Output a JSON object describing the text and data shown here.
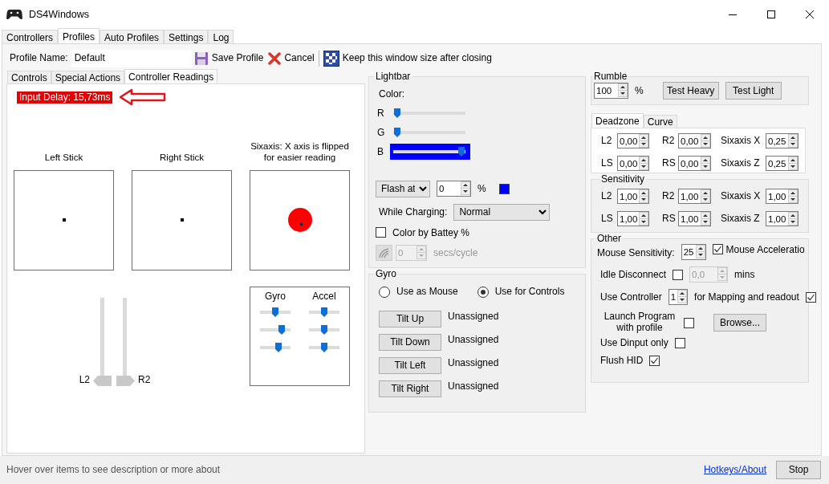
{
  "window": {
    "title": "DS4Windows"
  },
  "main_tabs": [
    {
      "label": "Controllers",
      "selected": false
    },
    {
      "label": "Profiles",
      "selected": true
    },
    {
      "label": "Auto Profiles",
      "selected": false
    },
    {
      "label": "Settings",
      "selected": false
    },
    {
      "label": "Log",
      "selected": false
    }
  ],
  "profile_bar": {
    "label": "Profile Name:",
    "value": "Default",
    "save": "Save Profile",
    "cancel": "Cancel",
    "keep_size": "Keep this window size after closing"
  },
  "sub_tabs": [
    {
      "label": "Controls",
      "selected": false
    },
    {
      "label": "Special Actions",
      "selected": false
    },
    {
      "label": "Controller Readings",
      "selected": true
    }
  ],
  "readings": {
    "input_delay": "Input Delay: 15,73ms",
    "sticks": [
      {
        "label": "Left Stick"
      },
      {
        "label": "Right Stick"
      }
    ],
    "sixaxis_label": "Sixaxis: X axis is flipped for easier reading",
    "triggers": [
      {
        "label": "L2",
        "level": 0
      },
      {
        "label": "R2",
        "level": 0
      }
    ],
    "motion": [
      {
        "label": "Gyro",
        "sliders": [
          {
            "level": 0.5
          },
          {
            "level": 0.78
          },
          {
            "level": 0.64
          }
        ]
      },
      {
        "label": "Accel",
        "sliders": [
          {
            "level": 0.5
          },
          {
            "level": 0.5
          },
          {
            "level": 0.5
          }
        ]
      }
    ]
  },
  "lightbar": {
    "title": "Lightbar",
    "color_label": "Color:",
    "color": "#0000ff",
    "channels": [
      {
        "label": "R",
        "level": 0,
        "highlighted": false
      },
      {
        "label": "G",
        "level": 0,
        "highlighted": false
      },
      {
        "label": "B",
        "level": 1,
        "highlighted": true
      }
    ],
    "flash": {
      "mode": "Flash at",
      "value": "0",
      "unit": "%"
    },
    "while_charging": {
      "label": "While Charging:",
      "value": "Normal"
    },
    "color_by_battery": {
      "label": "Color by Battey %",
      "checked": false
    },
    "rainbow": {
      "value": "0",
      "unit": "secs/cycle",
      "disabled": true
    }
  },
  "gyro": {
    "title": "Gyro",
    "modes": [
      {
        "label": "Use as Mouse",
        "selected": false
      },
      {
        "label": "Use for Controls",
        "selected": true
      }
    ],
    "tilts": [
      {
        "button": "Tilt Up",
        "value": "Unassigned"
      },
      {
        "button": "Tilt Down",
        "value": "Unassigned"
      },
      {
        "button": "Tilt Left",
        "value": "Unassigned"
      },
      {
        "button": "Tilt Right",
        "value": "Unassigned"
      }
    ]
  },
  "rumble": {
    "title": "Rumble",
    "value": "100",
    "unit": "%",
    "buttons": [
      "Test Heavy",
      "Test Light"
    ]
  },
  "curve_tabs": [
    {
      "label": "Deadzone",
      "selected": true
    },
    {
      "label": "Curve",
      "selected": false
    }
  ],
  "deadzone": [
    [
      {
        "label": "L2",
        "value": "0,00"
      },
      {
        "label": "R2",
        "value": "0,00"
      },
      {
        "label": "Sixaxis X",
        "value": "0,25"
      }
    ],
    [
      {
        "label": "LS",
        "value": "0,00"
      },
      {
        "label": "RS",
        "value": "0,00"
      },
      {
        "label": "Sixaxis Z",
        "value": "0,25"
      }
    ]
  ],
  "sensitivity": {
    "title": "Sensitivity",
    "rows": [
      [
        {
          "label": "L2",
          "value": "1,00"
        },
        {
          "label": "R2",
          "value": "1,00"
        },
        {
          "label": "Sixaxis X",
          "value": "1,00"
        }
      ],
      [
        {
          "label": "LS",
          "value": "1,00"
        },
        {
          "label": "RS",
          "value": "1,00"
        },
        {
          "label": "Sixaxis Z",
          "value": "1,00"
        }
      ]
    ]
  },
  "other": {
    "title": "Other",
    "mouse_sensitivity": {
      "label": "Mouse Sensitivity:",
      "value": "25"
    },
    "mouse_acceleration": {
      "label": "Mouse Acceleratio",
      "checked": true
    },
    "idle_disconnect": {
      "label": "Idle Disconnect",
      "checked": false,
      "value": "0,0",
      "unit": "mins",
      "disabled": true
    },
    "use_controller": {
      "label": "Use Controller",
      "value": "1",
      "suffix": "for Mapping and readout",
      "checked": true
    },
    "launch_program": {
      "label": "Launch Program with profile",
      "checked": false,
      "button": "Browse..."
    },
    "dinput_only": {
      "label": "Use Dinput only",
      "checked": false
    },
    "flush_hid": {
      "label": "Flush HID",
      "checked": true
    }
  },
  "status_bar": {
    "text": "Hover over items to see description or more about",
    "link": "Hotkeys/About",
    "button": "Stop"
  }
}
